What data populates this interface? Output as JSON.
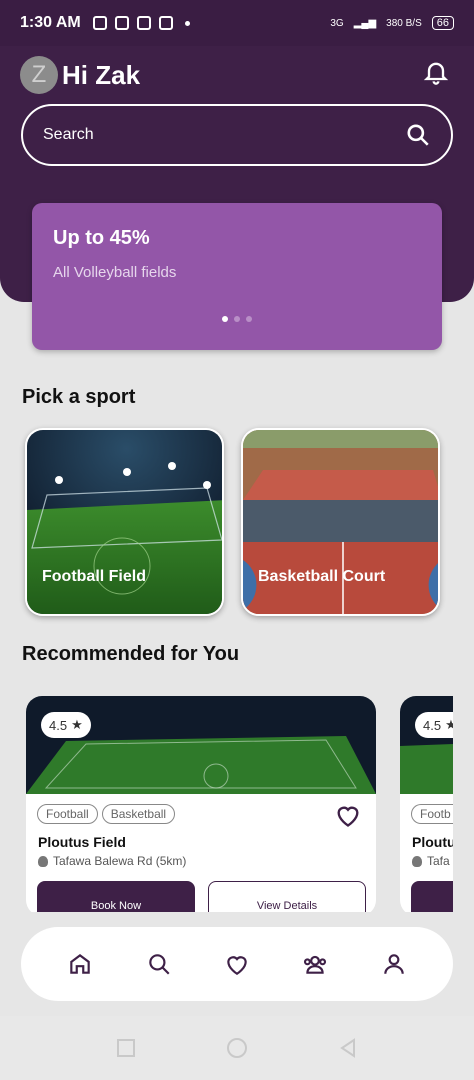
{
  "status": {
    "time": "1:30 AM",
    "network": "3G",
    "speed": "380 B/S",
    "battery": "66"
  },
  "header": {
    "avatar_letter": "Z",
    "greeting": "Hi Zak"
  },
  "search": {
    "placeholder": "Search"
  },
  "promo": {
    "title": "Up to 45%",
    "subtitle": "All Volleyball fields",
    "active_slide": 1,
    "slides": 3
  },
  "sports": {
    "title": "Pick a sport",
    "items": [
      {
        "label": "Football Field"
      },
      {
        "label": "Basketball Court"
      }
    ]
  },
  "recommended": {
    "title": "Recommended for You",
    "cards": [
      {
        "rating": "4.5",
        "tags": [
          "Football",
          "Basketball"
        ],
        "name": "Ploutus Field",
        "location": "Tafawa Balewa Rd (5km)",
        "book_label": "Book Now",
        "view_label": "View Details"
      },
      {
        "rating": "4.5",
        "tags": [
          "Footb"
        ],
        "name": "Ploutu",
        "location": "Tafa"
      }
    ]
  },
  "nav": {
    "items": [
      "home-icon",
      "search-icon",
      "heart-icon",
      "group-icon",
      "profile-icon"
    ]
  },
  "colors": {
    "primary": "#3e2047",
    "promo": "#9356a8"
  }
}
